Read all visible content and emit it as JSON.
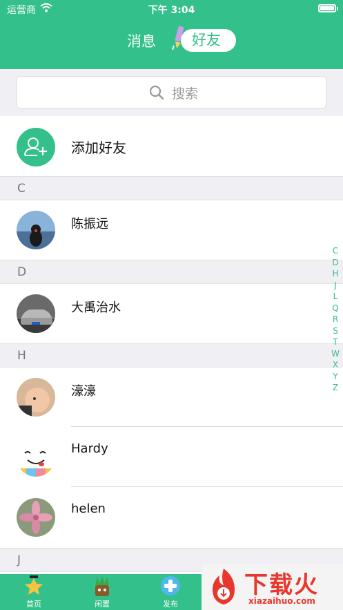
{
  "status_bar": {
    "carrier": "运营商",
    "time": "下午 3:04"
  },
  "header": {
    "tab_messages": "消息",
    "tab_friends": "好友"
  },
  "search": {
    "placeholder": "搜索"
  },
  "add_friend": {
    "label": "添加好友"
  },
  "sections": [
    {
      "letter": "C",
      "contacts": [
        {
          "name": "陈振远"
        }
      ]
    },
    {
      "letter": "D",
      "contacts": [
        {
          "name": "大禹治水"
        }
      ]
    },
    {
      "letter": "H",
      "contacts": [
        {
          "name": "濠濠"
        },
        {
          "name": "Hardy"
        },
        {
          "name": "helen"
        }
      ]
    },
    {
      "letter": "J",
      "contacts": []
    }
  ],
  "index_letters": [
    "C",
    "D",
    "H",
    "J",
    "L",
    "Q",
    "R",
    "S",
    "T",
    "W",
    "X",
    "Y",
    "Z"
  ],
  "tabbar": {
    "home": "首页",
    "idle": "闲置",
    "publish": "发布"
  },
  "watermark": {
    "title": "下载火",
    "subtitle": "xiazaihuo.com"
  },
  "colors": {
    "accent": "#33c08a",
    "section_bg": "#efeff4",
    "watermark_red": "#e8372d"
  }
}
